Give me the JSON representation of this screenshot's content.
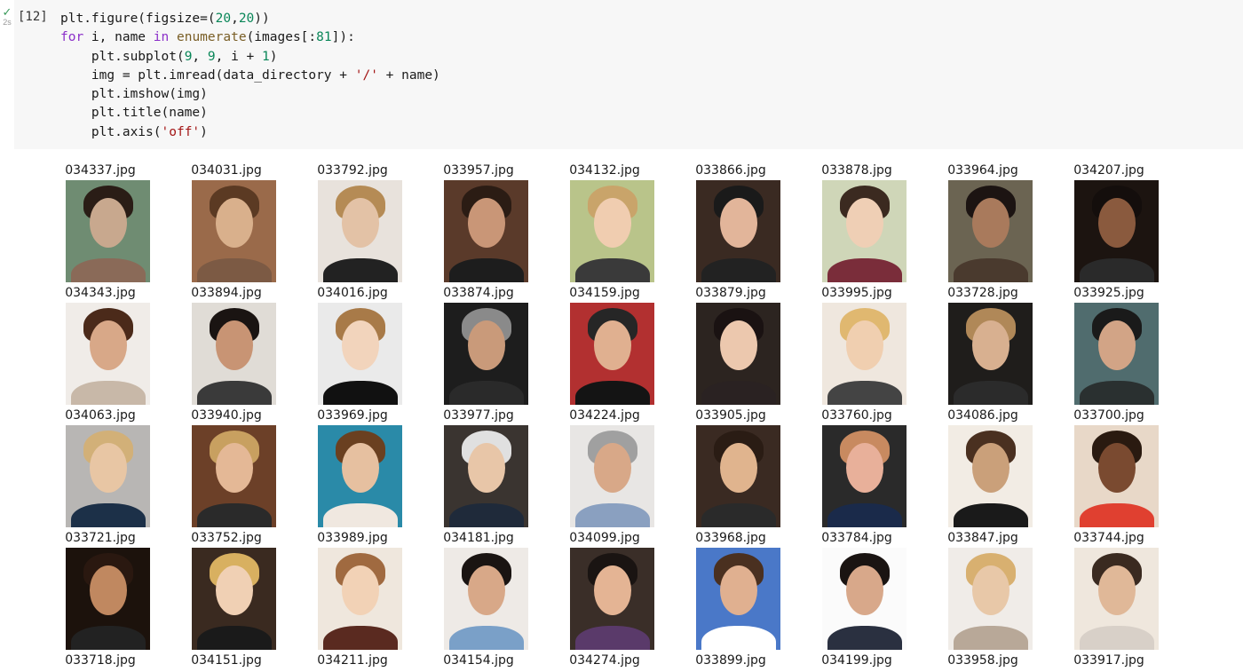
{
  "cell": {
    "execution_count": "[12]",
    "run_status": "✓",
    "duration": "2s"
  },
  "code_lines": [
    [
      {
        "t": "plt.figure(figsize=(",
        "c": "p"
      },
      {
        "t": "20",
        "c": "num"
      },
      {
        "t": ",",
        "c": "p"
      },
      {
        "t": "20",
        "c": "num"
      },
      {
        "t": "))",
        "c": "p"
      }
    ],
    [
      {
        "t": "for",
        "c": "kw"
      },
      {
        "t": " i, name ",
        "c": "p"
      },
      {
        "t": "in",
        "c": "kw"
      },
      {
        "t": " ",
        "c": "p"
      },
      {
        "t": "enumerate",
        "c": "fn"
      },
      {
        "t": "(images[:",
        "c": "p"
      },
      {
        "t": "81",
        "c": "num"
      },
      {
        "t": "]):",
        "c": "p"
      }
    ],
    [
      {
        "t": "    plt.subplot(",
        "c": "p"
      },
      {
        "t": "9",
        "c": "num"
      },
      {
        "t": ", ",
        "c": "p"
      },
      {
        "t": "9",
        "c": "num"
      },
      {
        "t": ", i + ",
        "c": "p"
      },
      {
        "t": "1",
        "c": "num"
      },
      {
        "t": ")",
        "c": "p"
      }
    ],
    [
      {
        "t": "    img = plt.imread(data_directory + ",
        "c": "p"
      },
      {
        "t": "'/'",
        "c": "str"
      },
      {
        "t": " + name)",
        "c": "p"
      }
    ],
    [
      {
        "t": "    plt.imshow(img)",
        "c": "p"
      }
    ],
    [
      {
        "t": "    plt.title(name)",
        "c": "p"
      }
    ],
    [
      {
        "t": "    plt.axis(",
        "c": "p"
      },
      {
        "t": "'off'",
        "c": "str"
      },
      {
        "t": ")",
        "c": "p"
      }
    ]
  ],
  "output": {
    "rows": [
      [
        "034337.jpg",
        "034031.jpg",
        "033792.jpg",
        "033957.jpg",
        "034132.jpg",
        "033866.jpg",
        "033878.jpg",
        "033964.jpg",
        "034207.jpg"
      ],
      [
        "034343.jpg",
        "033894.jpg",
        "034016.jpg",
        "033874.jpg",
        "034159.jpg",
        "033879.jpg",
        "033995.jpg",
        "033728.jpg",
        "033925.jpg"
      ],
      [
        "034063.jpg",
        "033940.jpg",
        "033969.jpg",
        "033977.jpg",
        "034224.jpg",
        "033905.jpg",
        "033760.jpg",
        "034086.jpg",
        "033700.jpg"
      ],
      [
        "033721.jpg",
        "033752.jpg",
        "033989.jpg",
        "034181.jpg",
        "034099.jpg",
        "033968.jpg",
        "033784.jpg",
        "033847.jpg",
        "033744.jpg"
      ],
      [
        "033718.jpg",
        "034151.jpg",
        "034211.jpg",
        "034154.jpg",
        "034274.jpg",
        "033899.jpg",
        "034199.jpg",
        "033958.jpg",
        "033917.jpg"
      ]
    ]
  }
}
